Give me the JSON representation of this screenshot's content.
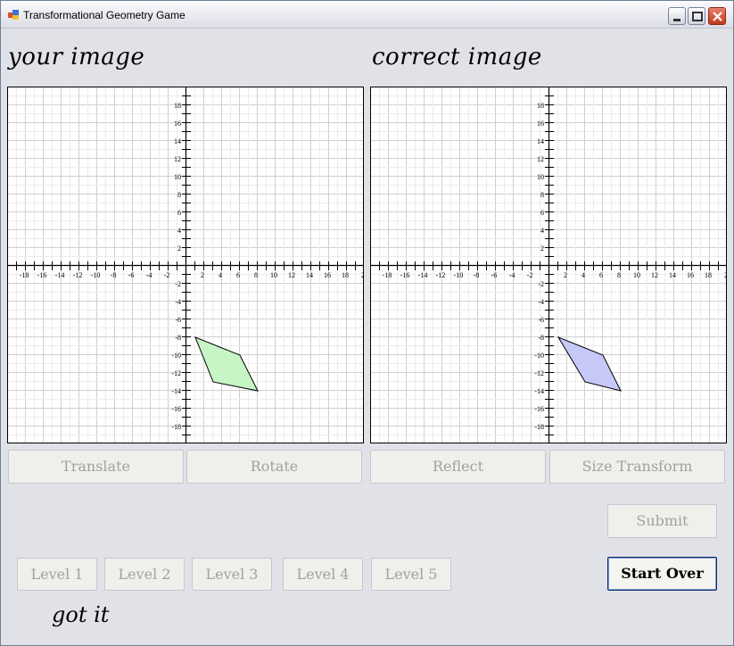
{
  "window": {
    "title": "Transformational Geometry Game"
  },
  "captions": {
    "left": "your image",
    "right": "correct image"
  },
  "graphs": {
    "tick_labels_x": [
      "-18",
      "-16",
      "-14",
      "-12",
      "-10",
      "-8",
      "-6",
      "-4",
      "-2",
      "2",
      "4",
      "6",
      "8",
      "10",
      "12",
      "14",
      "16",
      "18",
      "2"
    ],
    "tick_labels_y": [
      "18",
      "16",
      "14",
      "12",
      "10",
      "8",
      "6",
      "4",
      "2",
      "-2",
      "-4",
      "-6",
      "-8",
      "-10",
      "-12",
      "-14",
      "-16",
      "-18"
    ],
    "range": [
      -20,
      20
    ],
    "your_shape": {
      "vertices": [
        [
          1,
          -8
        ],
        [
          6,
          -10
        ],
        [
          8,
          -14
        ],
        [
          3,
          -13
        ]
      ],
      "fill": "#c8f5c6"
    },
    "correct_shape": {
      "vertices": [
        [
          1,
          -8
        ],
        [
          6,
          -10
        ],
        [
          8,
          -14
        ],
        [
          4,
          -13
        ]
      ],
      "fill": "#c6c8f7"
    }
  },
  "buttons": {
    "translate": "Translate",
    "rotate": "Rotate",
    "reflect": "Reflect",
    "size_transform": "Size Transform",
    "submit": "Submit",
    "start_over": "Start Over",
    "levels": [
      "Level 1",
      "Level 2",
      "Level 3",
      "Level 4",
      "Level 5"
    ]
  },
  "status_text": "got it"
}
